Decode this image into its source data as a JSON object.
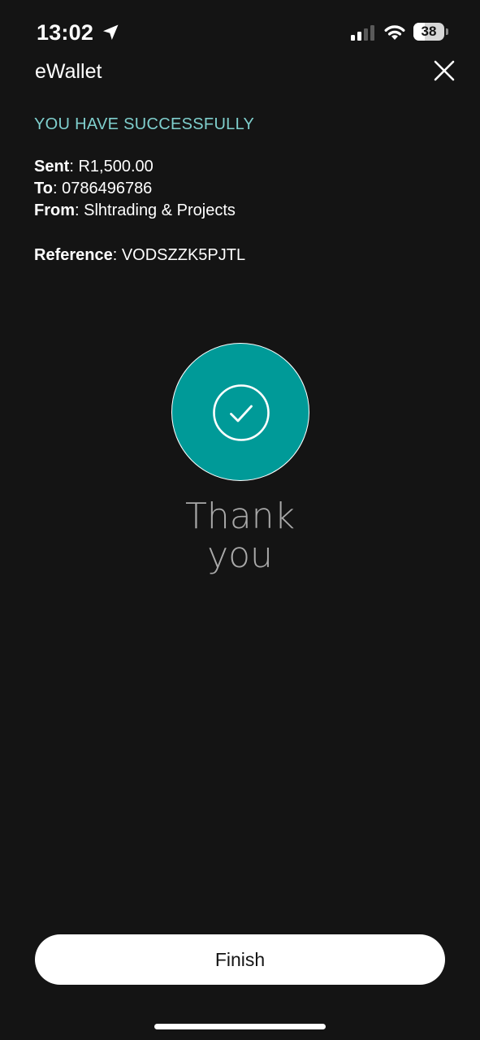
{
  "status_bar": {
    "time": "13:02",
    "battery_percent": "38",
    "battery_level": 0.38,
    "icons": [
      "location-arrow-icon",
      "signal-icon",
      "wifi-icon",
      "battery-icon"
    ]
  },
  "header": {
    "title": "eWallet",
    "close_icon": "close-icon"
  },
  "details": {
    "heading": "YOU HAVE SUCCESSFULLY",
    "sent_label": "Sent",
    "sent_value": "R1,500.00",
    "to_label": "To",
    "to_value": "0786496786",
    "from_label": "From",
    "from_value": "Slhtrading & Projects",
    "reference_label": "Reference",
    "reference_value": "VODSZZK5PJTL"
  },
  "success": {
    "icon": "check-circle-icon",
    "line1": "Thank",
    "line2": "you"
  },
  "actions": {
    "finish_label": "Finish"
  },
  "colors": {
    "background": "#141414",
    "accent": "#009a98",
    "heading": "#7fcfcd",
    "thank_you": "#a9a9a9"
  }
}
